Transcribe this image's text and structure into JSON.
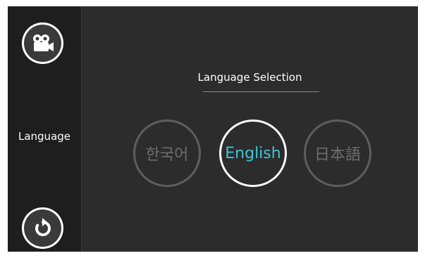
{
  "sidebar": {
    "top_button_icon": "video-camera-icon",
    "label": "Language",
    "bottom_button_icon": "refresh-icon"
  },
  "main": {
    "title": "Language Selection",
    "languages": [
      {
        "label": "한국어",
        "selected": false
      },
      {
        "label": "English",
        "selected": true
      },
      {
        "label": "日本語",
        "selected": false
      }
    ]
  },
  "colors": {
    "background": "#2c2c2c",
    "sidebar": "#1e1e1e",
    "accent": "#3ec6d6",
    "inactive": "#6e6e6e"
  }
}
